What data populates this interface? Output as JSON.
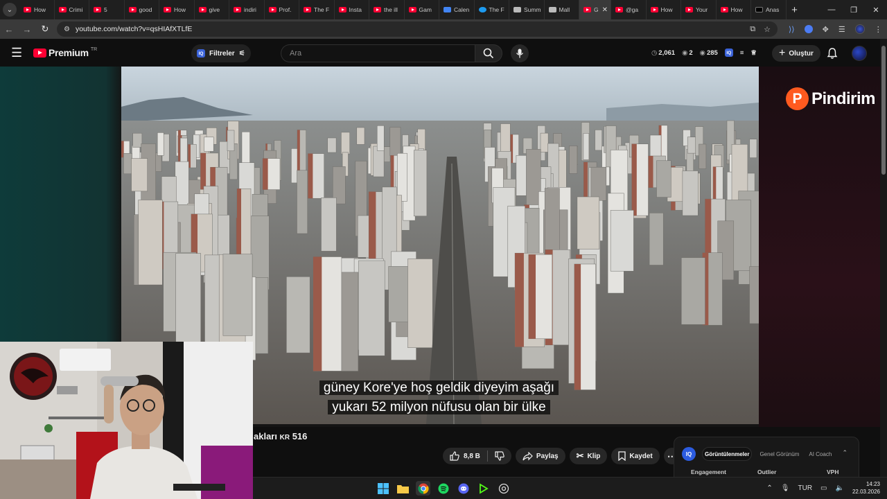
{
  "browser": {
    "tabs": [
      {
        "label": "How",
        "icon": "youtube-icon"
      },
      {
        "label": "Crimi",
        "icon": "youtube-icon"
      },
      {
        "label": "5",
        "icon": "youtube-icon"
      },
      {
        "label": "good",
        "icon": "youtube-icon"
      },
      {
        "label": "How",
        "icon": "youtube-icon"
      },
      {
        "label": "give",
        "icon": "youtube-icon"
      },
      {
        "label": "indiri",
        "icon": "youtube-icon"
      },
      {
        "label": "Prof.",
        "icon": "youtube-icon"
      },
      {
        "label": "The F",
        "icon": "youtube-icon"
      },
      {
        "label": "Insta",
        "icon": "youtube-icon"
      },
      {
        "label": "the ill",
        "icon": "youtube-icon"
      },
      {
        "label": "Gam",
        "icon": "youtube-icon"
      },
      {
        "label": "Calen",
        "icon": "calendar-icon"
      },
      {
        "label": "The F",
        "icon": "bird-icon"
      },
      {
        "label": "Summ",
        "icon": "stack-icon"
      },
      {
        "label": "Mall",
        "icon": "stack-icon"
      },
      {
        "label": "G",
        "icon": "youtube-icon",
        "active": true
      },
      {
        "label": "@ga",
        "icon": "youtube-icon"
      },
      {
        "label": "How",
        "icon": "youtube-icon"
      },
      {
        "label": "Your",
        "icon": "youtube-icon"
      },
      {
        "label": "How",
        "icon": "youtube-icon"
      },
      {
        "label": "Anas",
        "icon": "x-icon"
      }
    ],
    "url": "youtube.com/watch?v=qsHIAfXTLfE"
  },
  "masthead": {
    "logo_text": "Premium",
    "country_code": "TR",
    "filters_label": "Filtreler",
    "filters_badge": "IQ",
    "search_placeholder": "Ara",
    "stats": {
      "views": "2,061",
      "live": "2",
      "count": "285"
    },
    "create_label": "Oluştur"
  },
  "player": {
    "subtitle_line1": "güney Kore'ye hoş geldik diyeyim aşağı",
    "subtitle_line2": "yukarı 52 milyon nüfusu olan bir ülke",
    "sponsor_logo": "P",
    "sponsor_text": "Pindirim"
  },
  "video_info": {
    "title_partial": "akları",
    "price_code": "KR",
    "price_value": "516",
    "likes": "8,8 B",
    "share_label": "Paylaş",
    "clip_label": "Klip",
    "save_label": "Kaydet"
  },
  "iq_panel": {
    "logo": "IQ",
    "tabs": [
      "Görüntülenmeler",
      "Genel Görünüm",
      "AI Coach"
    ],
    "active_tab": 0,
    "columns": [
      "Engagement",
      "Outlier",
      "VPH"
    ]
  },
  "taskbar": {
    "language": "TUR",
    "time": "14:23",
    "date": "22.03.2026"
  },
  "colors": {
    "youtube_red": "#ff0033",
    "iq_blue": "#2c5ce0",
    "sponsor_orange": "#ff5a1f"
  }
}
